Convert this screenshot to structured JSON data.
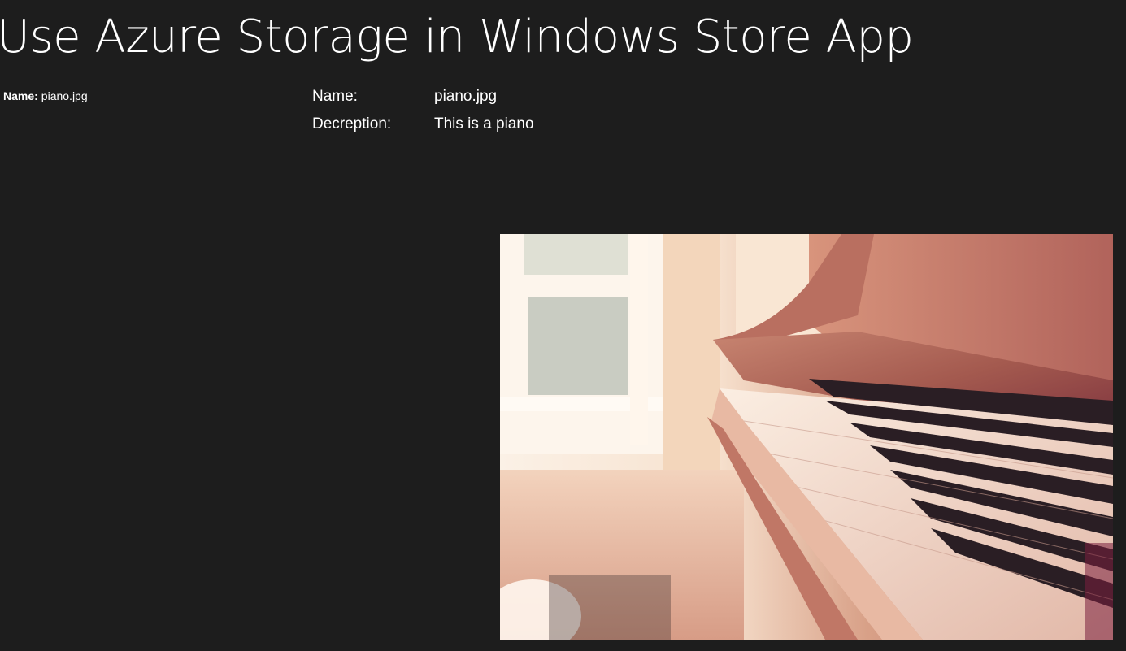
{
  "header": {
    "title": "Use Azure Storage in Windows Store App"
  },
  "list": {
    "items": [
      {
        "label": "Name:",
        "value": "piano.jpg"
      }
    ]
  },
  "details": {
    "name_label": "Name:",
    "name_value": "piano.jpg",
    "description_label": "Decreption:",
    "description_value": "This is a piano"
  },
  "image": {
    "subject": "piano photo",
    "colors": {
      "background": "#1d1d1d",
      "wood": "#a45a4f",
      "window_light": "#fbeee0",
      "keys_white": "#f2dcc8",
      "keys_black": "#2a1e24"
    }
  }
}
